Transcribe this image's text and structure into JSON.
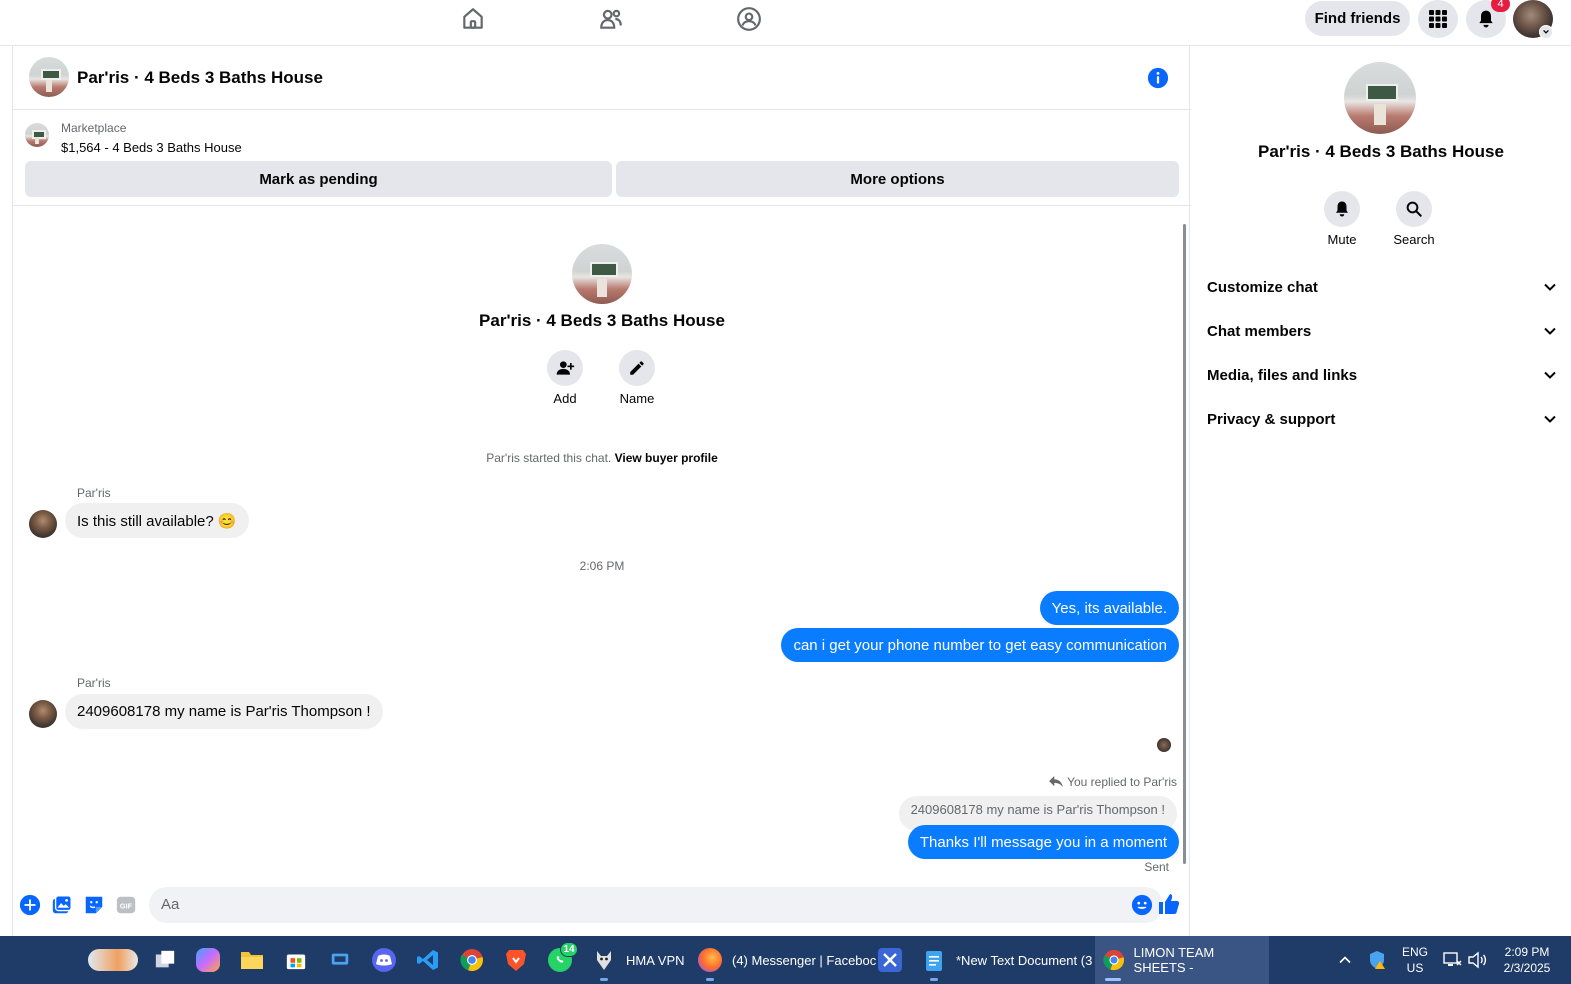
{
  "topbar": {
    "nav": [
      "home-icon",
      "friends-icon",
      "groups-icon"
    ],
    "find_friends": "Find friends",
    "notification_count": "4"
  },
  "chat": {
    "title": "Par'ris · 4 Beds 3 Baths House",
    "marketplace_label": "Marketplace",
    "listing": "$1,564 - 4 Beds 3 Baths House",
    "mark_pending": "Mark as pending",
    "more_options": "More options",
    "center_title": "Par'ris · 4 Beds 3 Baths House",
    "actions": {
      "add": "Add",
      "name": "Name"
    },
    "started_text": "Par'ris started this chat.",
    "view_profile": "View buyer profile",
    "timestamp": "2:06 PM",
    "messages": [
      {
        "sender": "Par'ris",
        "text": "Is this still available? 😊",
        "direction": "in"
      },
      {
        "text": "Yes, its available.",
        "direction": "out"
      },
      {
        "text": "can i get your phone number to get easy communication",
        "direction": "out"
      },
      {
        "sender": "Par'ris",
        "text": "2409608178 my name is Par'ris Thompson !",
        "direction": "in"
      },
      {
        "text": "Thanks I'll message you in a moment",
        "direction": "out"
      }
    ],
    "reply_note": "You replied to Par'ris",
    "quoted": "2409608178 my name is Par'ris Thompson !",
    "status": "Sent",
    "composer_placeholder": "Aa",
    "accent": "#0a7cff"
  },
  "right_panel": {
    "title": "Par'ris · 4 Beds 3 Baths House",
    "mute": "Mute",
    "search": "Search",
    "sections": [
      "Customize chat",
      "Chat members",
      "Media, files and links",
      "Privacy & support"
    ]
  },
  "taskbar": {
    "apps": {
      "whatsapp_badge": "14",
      "hma": "HMA VPN",
      "firefox": "(4) Messenger | Faceboc",
      "notepad": "*New Text Document (3",
      "chrome": "LIMON TEAM SHEETS -"
    },
    "lang": "ENG",
    "region": "US",
    "time": "2:09 PM",
    "date": "2/3/2025"
  }
}
